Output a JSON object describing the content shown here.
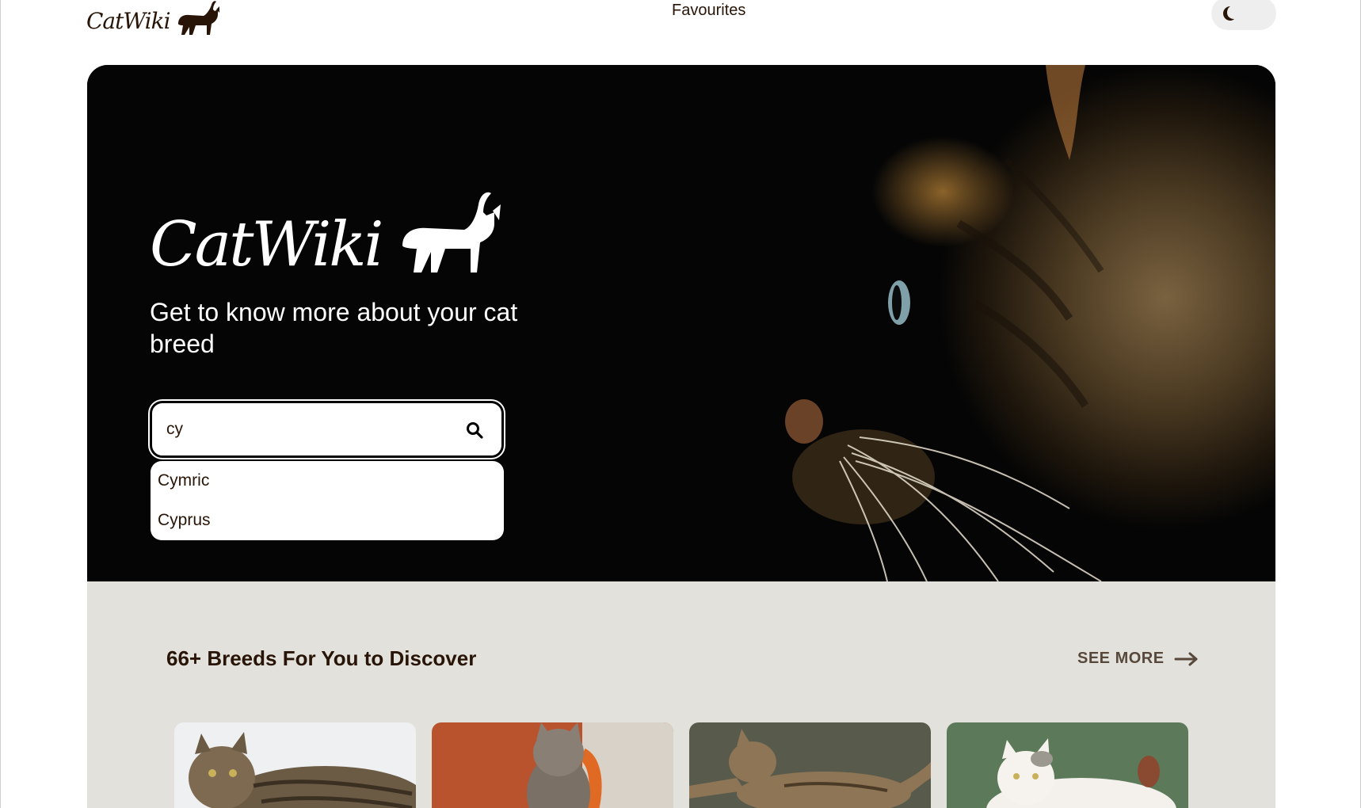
{
  "header": {
    "brand": "CatWiki",
    "nav_favourites": "Favourites",
    "theme_toggle_icon": "moon-icon"
  },
  "hero": {
    "title": "CatWiki",
    "subtitle": "Get to know more about your cat breed",
    "search": {
      "value": "cy",
      "icon": "search-icon"
    },
    "suggestions": [
      "Cymric",
      "Cyprus"
    ]
  },
  "breeds": {
    "title": "66+ Breeds For You to Discover",
    "see_more": "SEE MORE",
    "see_more_icon": "arrow-right-icon"
  },
  "colors": {
    "text_brown": "#291507",
    "hero_bg": "#050505",
    "section_bg": "#e3e1dc"
  }
}
